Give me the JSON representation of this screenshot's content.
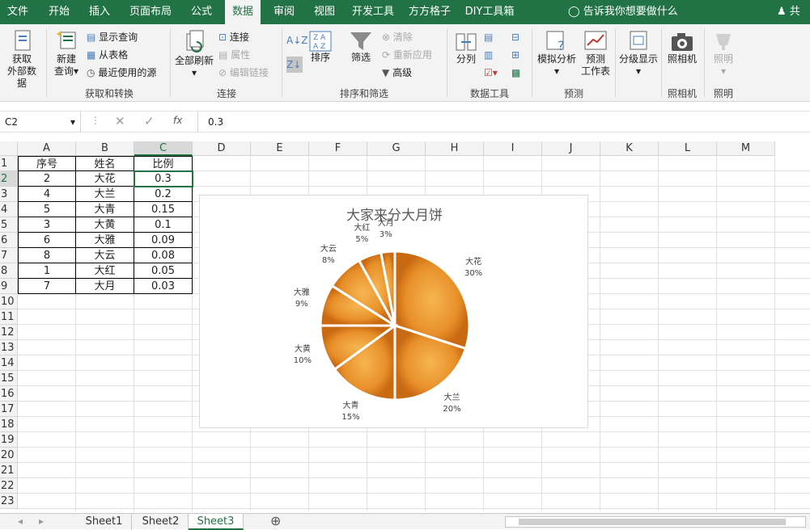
{
  "tabs": [
    "文件",
    "开始",
    "插入",
    "页面布局",
    "公式",
    "数据",
    "审阅",
    "视图",
    "开发工具",
    "方方格子",
    "DIY工具箱"
  ],
  "active_tab": "数据",
  "tell_me": "告诉我你想要做什么",
  "share": "共享",
  "ribbon": {
    "get_external_line1": "获取",
    "get_external_line2": "外部数据",
    "new_query_line1": "新建",
    "new_query_line2": "查询",
    "show_queries": "显示查询",
    "from_table": "从表格",
    "recent_sources": "最近使用的源",
    "group_get_transform": "获取和转换",
    "refresh_all": "全部刷新",
    "connections": "连接",
    "properties": "属性",
    "edit_links": "编辑链接",
    "group_connections": "连接",
    "sort": "排序",
    "filter": "筛选",
    "clear": "清除",
    "reapply": "重新应用",
    "advanced": "高级",
    "group_sort_filter": "排序和筛选",
    "text_to_columns": "分列",
    "group_data_tools": "数据工具",
    "what_if_analysis": "模拟分析",
    "forecast_line1": "预测",
    "forecast_line2": "工作表",
    "group_forecast": "预测",
    "outline": "分级显示",
    "camera": "照相机",
    "group_camera": "照相机",
    "lighting": "照明",
    "group_lighting": "照明"
  },
  "formula_bar": {
    "name_box": "C2",
    "fx": "fx",
    "value": "0.3"
  },
  "columns": [
    "A",
    "B",
    "C",
    "D",
    "E",
    "F",
    "G",
    "H",
    "I",
    "J",
    "K",
    "L",
    "M"
  ],
  "rows": [
    "1",
    "2",
    "3",
    "4",
    "5",
    "6",
    "7",
    "8",
    "9",
    "10",
    "11",
    "12",
    "13",
    "14",
    "15",
    "16",
    "17",
    "18",
    "19",
    "20",
    "21",
    "22",
    "23"
  ],
  "table": {
    "headers": [
      "序号",
      "姓名",
      "比例"
    ],
    "rows": [
      [
        "2",
        "大花",
        "0.3"
      ],
      [
        "4",
        "大兰",
        "0.2"
      ],
      [
        "5",
        "大青",
        "0.15"
      ],
      [
        "3",
        "大黄",
        "0.1"
      ],
      [
        "6",
        "大雅",
        "0.09"
      ],
      [
        "8",
        "大云",
        "0.08"
      ],
      [
        "1",
        "大红",
        "0.05"
      ],
      [
        "7",
        "大月",
        "0.03"
      ]
    ]
  },
  "chart_data": {
    "type": "pie",
    "title": "大家来分大月饼",
    "categories": [
      "大花",
      "大兰",
      "大青",
      "大黄",
      "大雅",
      "大云",
      "大红",
      "大月"
    ],
    "values": [
      0.3,
      0.2,
      0.15,
      0.1,
      0.09,
      0.08,
      0.05,
      0.03
    ],
    "labels": [
      "30%",
      "20%",
      "15%",
      "10%",
      "9%",
      "8%",
      "5%",
      "3%"
    ],
    "slice_color": "#e8902a"
  },
  "sheets": [
    "Sheet1",
    "Sheet2",
    "Sheet3"
  ],
  "active_sheet": "Sheet3",
  "colors": {
    "accent": "#217346",
    "mooncake": "#e8902a"
  }
}
